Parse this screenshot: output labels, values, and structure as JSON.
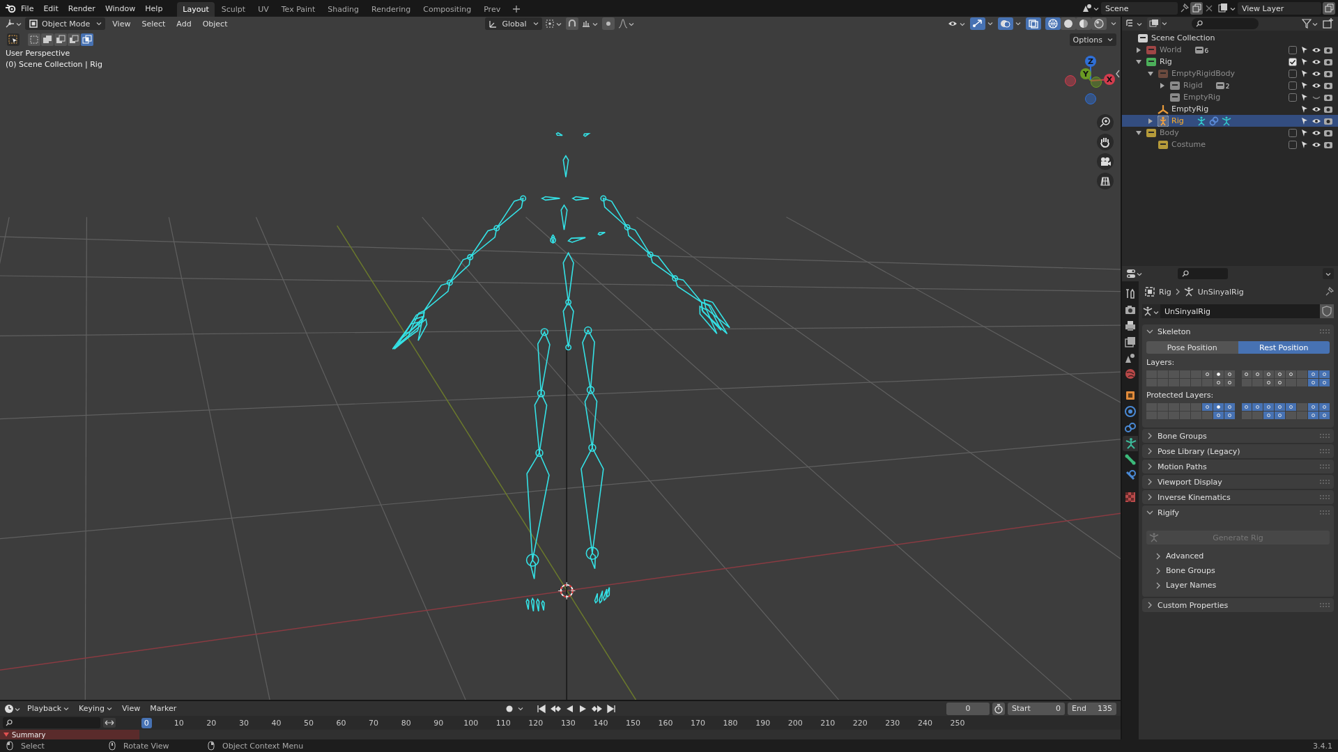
{
  "topbar": {
    "menus": [
      "File",
      "Edit",
      "Render",
      "Window",
      "Help"
    ],
    "workspaces": [
      {
        "label": "Layout",
        "selected": true
      },
      {
        "label": "Sculpt",
        "selected": false
      },
      {
        "label": "UV",
        "selected": false
      },
      {
        "label": "Tex Paint",
        "selected": false
      },
      {
        "label": "Shading",
        "selected": false
      },
      {
        "label": "Rendering",
        "selected": false
      },
      {
        "label": "Compositing",
        "selected": false
      },
      {
        "label": "Prev",
        "selected": false
      }
    ],
    "scene": "Scene",
    "view_layer": "View Layer"
  },
  "viewport": {
    "mode": "Object Mode",
    "menus": [
      "View",
      "Select",
      "Add",
      "Object"
    ],
    "orientation": "Global",
    "options": "Options",
    "selection_modes": [
      {
        "selected": false
      },
      {
        "selected": false
      },
      {
        "selected": false
      },
      {
        "selected": false
      },
      {
        "selected": true
      }
    ],
    "shading": [
      {
        "kind": "wireframe",
        "selected": true
      },
      {
        "kind": "solid",
        "selected": false
      },
      {
        "kind": "material",
        "selected": false
      },
      {
        "kind": "rendered",
        "selected": false
      }
    ],
    "overlay_lines": [
      "User Perspective",
      "(0) Scene Collection | Rig"
    ],
    "axes": [
      {
        "label": "Z",
        "color": "#2f6fd6"
      },
      {
        "label": "Y",
        "color": "#6a9a23"
      },
      {
        "label": "X",
        "color": "#d43c4e"
      }
    ]
  },
  "outliner": {
    "root": "Scene Collection",
    "items": [
      {
        "name": "World",
        "kind": "collection",
        "color": "#a04646",
        "expanded": false,
        "dimmed": true,
        "checked": false,
        "visible": true,
        "count": "6",
        "selected": false
      },
      {
        "name": "Rig",
        "kind": "collection",
        "color": "#4caf5a",
        "expanded": true,
        "dimmed": false,
        "checked": true,
        "visible": true,
        "selected": false,
        "children": [
          {
            "name": "EmptyRigidBody",
            "kind": "collection",
            "color": "#6b4a3e",
            "expanded": true,
            "dimmed": true,
            "checked": false,
            "visible": true,
            "selected": false,
            "children": [
              {
                "name": "Rigid",
                "kind": "collection",
                "color": "#8a8a8a",
                "expanded": false,
                "dimmed": true,
                "checked": false,
                "visible": true,
                "count": "2",
                "selected": false
              },
              {
                "name": "EmptyRig",
                "kind": "collection",
                "color": "#8a8a8a",
                "dimmed": true,
                "checked": false,
                "visible": false,
                "selected": false
              }
            ]
          },
          {
            "name": "EmptyRig",
            "kind": "empty",
            "dimmed": false,
            "visible": true,
            "selected": false
          },
          {
            "name": "Rig",
            "kind": "armature",
            "expanded": false,
            "dimmed": false,
            "visible": true,
            "selected": true
          }
        ]
      },
      {
        "name": "Body",
        "kind": "collection",
        "color": "#b59a3a",
        "expanded": true,
        "dimmed": true,
        "checked": false,
        "visible": true,
        "selected": false,
        "children": [
          {
            "name": "Costume",
            "kind": "collection",
            "color": "#b59a3a",
            "dimmed": true,
            "checked": false,
            "visible": true,
            "selected": false
          }
        ]
      }
    ]
  },
  "properties": {
    "tabs": [
      {
        "kind": "tool",
        "selected": false
      },
      {
        "kind": "render",
        "selected": false
      },
      {
        "kind": "output",
        "selected": false
      },
      {
        "kind": "view_layer",
        "selected": false
      },
      {
        "kind": "scene",
        "selected": false
      },
      {
        "kind": "world",
        "selected": false
      },
      {
        "kind": "object",
        "selected": false
      },
      {
        "kind": "physics",
        "selected": false
      },
      {
        "kind": "constraints",
        "selected": false
      },
      {
        "kind": "data",
        "selected": true
      },
      {
        "kind": "bone",
        "selected": false
      },
      {
        "kind": "bone_constraint",
        "selected": false
      },
      {
        "kind": "texture",
        "selected": false
      }
    ],
    "breadcrumb": [
      "Rig",
      "UnSinyalRig"
    ],
    "datablock": "UnSinyalRig",
    "panels": [
      {
        "kind": "skeleton",
        "title": "Skeleton",
        "expanded": true,
        "positions": [
          {
            "label": "Pose Position",
            "selected": false
          },
          {
            "label": "Rest Position",
            "selected": true
          }
        ],
        "layers_label": "Layers:",
        "protected_label": "Protected Layers:",
        "layers": [
          [
            [
              {
                "on": false,
                "bones": false,
                "active": false
              },
              {
                "on": false,
                "bones": false,
                "active": false
              },
              {
                "on": false,
                "bones": false,
                "active": false
              },
              {
                "on": false,
                "bones": false,
                "active": false
              },
              {
                "on": false,
                "bones": false,
                "active": false
              },
              {
                "on": false,
                "bones": true,
                "active": false
              },
              {
                "on": false,
                "bones": true,
                "active": true
              },
              {
                "on": false,
                "bones": true,
                "active": false
              }
            ],
            [
              {
                "on": false,
                "bones": false,
                "active": false
              },
              {
                "on": false,
                "bones": false,
                "active": false
              },
              {
                "on": false,
                "bones": false,
                "active": false
              },
              {
                "on": false,
                "bones": false,
                "active": false
              },
              {
                "on": false,
                "bones": false,
                "active": false
              },
              {
                "on": false,
                "bones": false,
                "active": false
              },
              {
                "on": false,
                "bones": true,
                "active": false
              },
              {
                "on": false,
                "bones": true,
                "active": false
              }
            ]
          ],
          [
            [
              {
                "on": false,
                "bones": true,
                "active": false
              },
              {
                "on": false,
                "bones": true,
                "active": false
              },
              {
                "on": false,
                "bones": true,
                "active": false
              },
              {
                "on": false,
                "bones": true,
                "active": false
              },
              {
                "on": false,
                "bones": true,
                "active": false
              },
              {
                "on": false,
                "bones": false,
                "active": false
              },
              {
                "on": true,
                "bones": true,
                "active": false
              },
              {
                "on": true,
                "bones": true,
                "active": false
              }
            ],
            [
              {
                "on": false,
                "bones": false,
                "active": false
              },
              {
                "on": false,
                "bones": false,
                "active": false
              },
              {
                "on": false,
                "bones": true,
                "active": false
              },
              {
                "on": false,
                "bones": true,
                "active": false
              },
              {
                "on": false,
                "bones": false,
                "active": false
              },
              {
                "on": false,
                "bones": false,
                "active": false
              },
              {
                "on": true,
                "bones": true,
                "active": false
              },
              {
                "on": true,
                "bones": true,
                "active": false
              }
            ]
          ]
        ],
        "protected": [
          [
            [
              {
                "on": false,
                "bones": false,
                "active": false
              },
              {
                "on": false,
                "bones": false,
                "active": false
              },
              {
                "on": false,
                "bones": false,
                "active": false
              },
              {
                "on": false,
                "bones": false,
                "active": false
              },
              {
                "on": false,
                "bones": false,
                "active": false
              },
              {
                "on": true,
                "bones": true,
                "active": false
              },
              {
                "on": true,
                "bones": true,
                "active": true
              },
              {
                "on": true,
                "bones": true,
                "active": false
              }
            ],
            [
              {
                "on": false,
                "bones": false,
                "active": false
              },
              {
                "on": false,
                "bones": false,
                "active": false
              },
              {
                "on": false,
                "bones": false,
                "active": false
              },
              {
                "on": false,
                "bones": false,
                "active": false
              },
              {
                "on": false,
                "bones": false,
                "active": false
              },
              {
                "on": false,
                "bones": false,
                "active": false
              },
              {
                "on": true,
                "bones": true,
                "active": false
              },
              {
                "on": true,
                "bones": true,
                "active": false
              }
            ]
          ],
          [
            [
              {
                "on": true,
                "bones": true,
                "active": false
              },
              {
                "on": true,
                "bones": true,
                "active": false
              },
              {
                "on": true,
                "bones": true,
                "active": false
              },
              {
                "on": true,
                "bones": true,
                "active": false
              },
              {
                "on": true,
                "bones": true,
                "active": false
              },
              {
                "on": false,
                "bones": false,
                "active": false
              },
              {
                "on": true,
                "bones": true,
                "active": false
              },
              {
                "on": true,
                "bones": true,
                "active": false
              }
            ],
            [
              {
                "on": false,
                "bones": false,
                "active": false
              },
              {
                "on": false,
                "bones": false,
                "active": false
              },
              {
                "on": true,
                "bones": true,
                "active": false
              },
              {
                "on": true,
                "bones": true,
                "active": false
              },
              {
                "on": false,
                "bones": false,
                "active": false
              },
              {
                "on": false,
                "bones": false,
                "active": false
              },
              {
                "on": true,
                "bones": true,
                "active": false
              },
              {
                "on": true,
                "bones": true,
                "active": false
              }
            ]
          ]
        ]
      },
      {
        "title": "Bone Groups",
        "expanded": false
      },
      {
        "title": "Pose Library (Legacy)",
        "expanded": false
      },
      {
        "title": "Motion Paths",
        "expanded": false
      },
      {
        "title": "Viewport Display",
        "expanded": false
      },
      {
        "title": "Inverse Kinematics",
        "expanded": false
      },
      {
        "kind": "rigify",
        "title": "Rigify",
        "expanded": true,
        "button": {
          "label": "Generate Rig",
          "disabled": true
        },
        "subpanels": [
          {
            "title": "Advanced",
            "expanded": false
          },
          {
            "title": "Bone Groups",
            "expanded": false
          },
          {
            "title": "Layer Names",
            "expanded": false
          }
        ]
      },
      {
        "title": "Custom Properties",
        "expanded": false
      }
    ]
  },
  "timeline": {
    "menus": [
      {
        "label": "Playback",
        "dropdown": true
      },
      {
        "label": "Keying",
        "dropdown": true
      },
      {
        "label": "View",
        "dropdown": false
      },
      {
        "label": "Marker",
        "dropdown": false
      }
    ],
    "current_frame": "0",
    "start_label": "Start",
    "start": "0",
    "end_label": "End",
    "end": "135",
    "ruler": [
      {
        "label": "0",
        "selected": true
      },
      {
        "label": "10",
        "selected": false
      },
      {
        "label": "20",
        "selected": false
      },
      {
        "label": "30",
        "selected": false
      },
      {
        "label": "40",
        "selected": false
      },
      {
        "label": "50",
        "selected": false
      },
      {
        "label": "60",
        "selected": false
      },
      {
        "label": "70",
        "selected": false
      },
      {
        "label": "80",
        "selected": false
      },
      {
        "label": "90",
        "selected": false
      },
      {
        "label": "100",
        "selected": false
      },
      {
        "label": "110",
        "selected": false
      },
      {
        "label": "120",
        "selected": false
      },
      {
        "label": "130",
        "selected": false
      },
      {
        "label": "140",
        "selected": false
      },
      {
        "label": "150",
        "selected": false
      },
      {
        "label": "160",
        "selected": false
      },
      {
        "label": "170",
        "selected": false
      },
      {
        "label": "180",
        "selected": false
      },
      {
        "label": "190",
        "selected": false
      },
      {
        "label": "200",
        "selected": false
      },
      {
        "label": "210",
        "selected": false
      },
      {
        "label": "220",
        "selected": false
      },
      {
        "label": "230",
        "selected": false
      },
      {
        "label": "240",
        "selected": false
      },
      {
        "label": "250",
        "selected": false
      }
    ],
    "channels": [
      {
        "name": "Summary",
        "expanded": true
      }
    ]
  },
  "status_bar": {
    "items": [
      {
        "kind": "left",
        "label": "Select"
      },
      {
        "kind": "middle",
        "label": "Rotate View"
      },
      {
        "kind": "right",
        "label": "Object Context Menu"
      }
    ],
    "version": "3.4.1"
  }
}
